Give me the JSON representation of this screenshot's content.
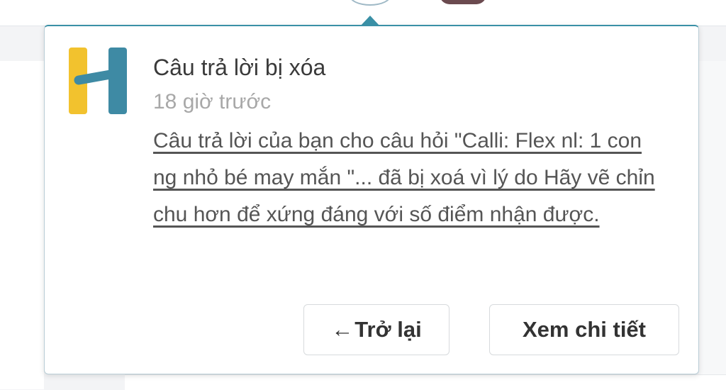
{
  "notification": {
    "title": "Câu trả lời bị xóa",
    "time": "18 giờ trước",
    "message": "Câu trả lời của bạn cho câu hỏi \"Calli: Flex nl: 1 con ng nhỏ bé may mắn  \"... đã bị xoá vì lý do Hãy vẽ chỉn chu hơn để xứng đáng với số điểm nhận được.",
    "logo_icon": "hoc247-h-logo-icon"
  },
  "buttons": {
    "back_arrow": "←",
    "back_label": "Trở lại",
    "detail_label": "Xem chi tiết"
  },
  "colors": {
    "accent": "#3a90a6",
    "logo_yellow": "#f2c22e",
    "logo_teal": "#3e8aa4"
  }
}
